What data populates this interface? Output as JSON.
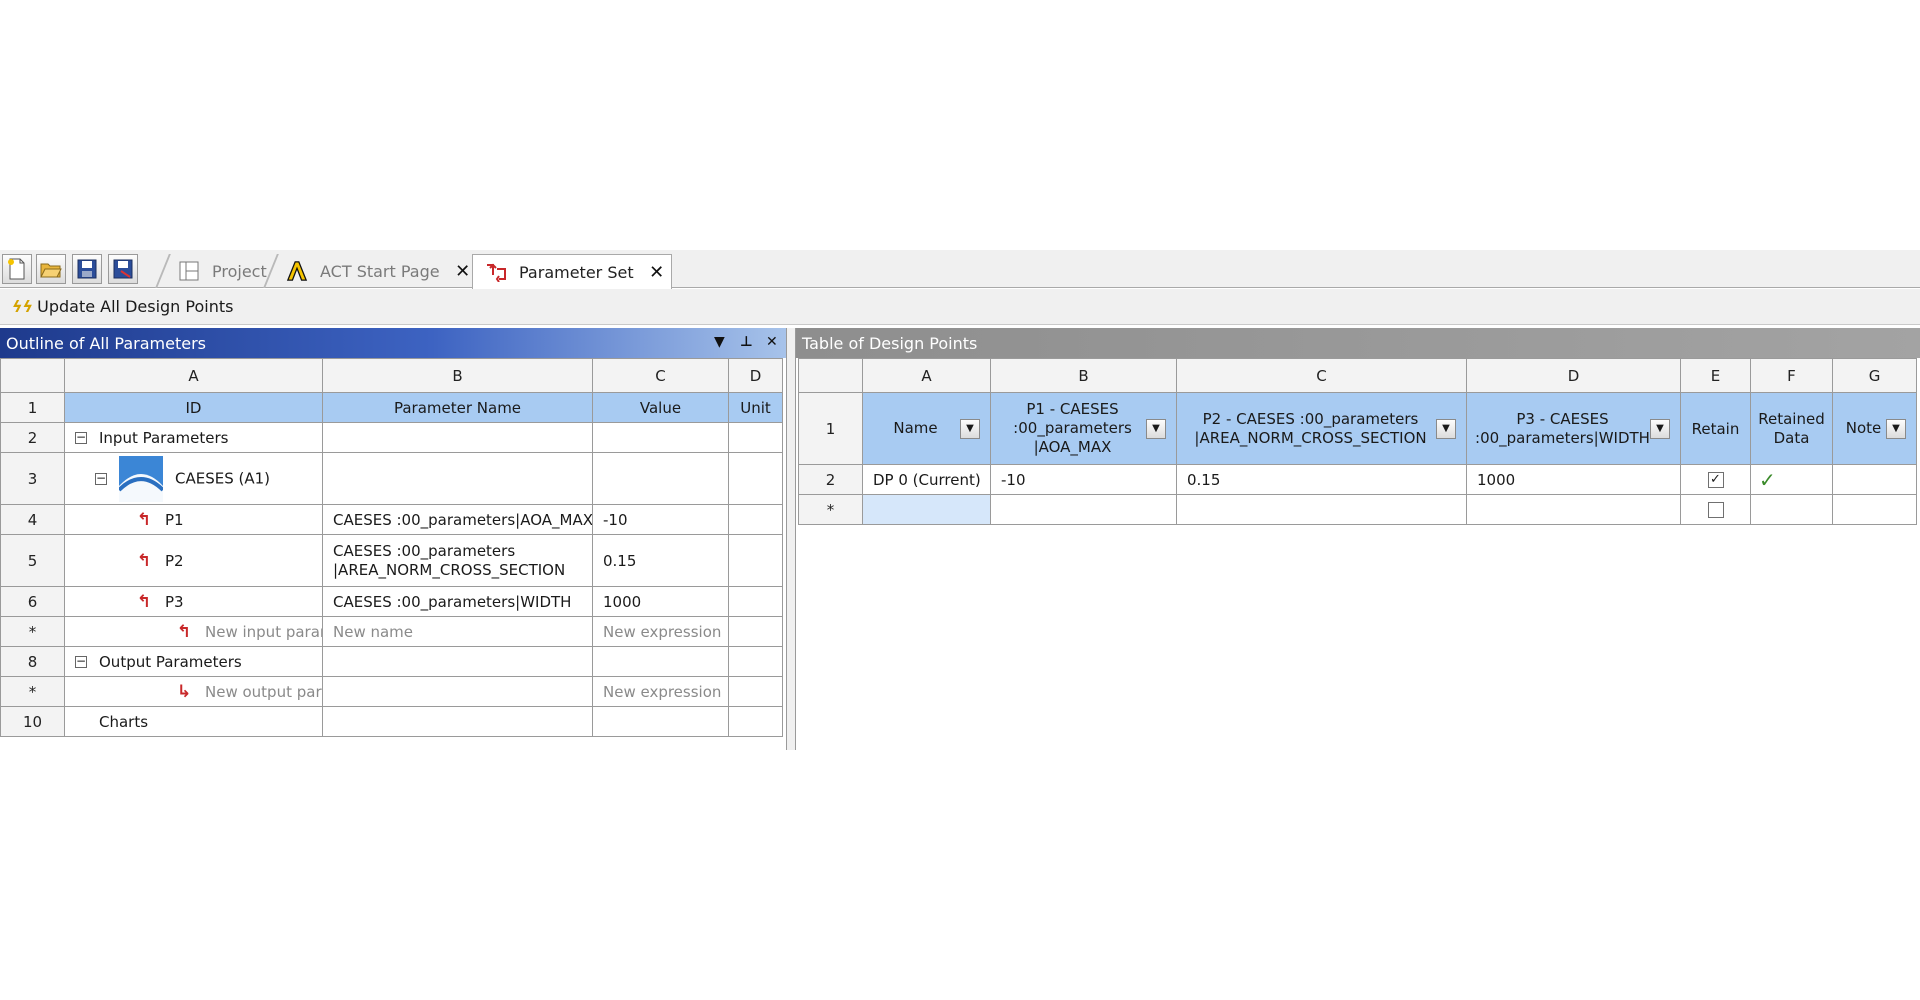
{
  "toolbar": {
    "buttons": [
      "new-file-icon",
      "open-folder-icon",
      "save-icon",
      "save-as-icon"
    ]
  },
  "tabs": [
    {
      "label": "Project",
      "icon": "project-icon",
      "active": false,
      "closable": false
    },
    {
      "label": "ACT Start Page",
      "icon": "ansys-logo-icon",
      "active": false,
      "closable": true
    },
    {
      "label": "Parameter Set",
      "icon": "parameter-set-icon",
      "active": true,
      "closable": true
    }
  ],
  "actions": {
    "update_all": "Update All Design Points"
  },
  "outline": {
    "title": "Outline of All Parameters",
    "columns": [
      "A",
      "B",
      "C",
      "D"
    ],
    "headers": [
      "ID",
      "Parameter Name",
      "Value",
      "Unit"
    ],
    "rows": [
      {
        "num": "2",
        "id": "Input Parameters",
        "name": "",
        "value": "",
        "unit": ""
      },
      {
        "num": "3",
        "id": "CAESES (A1)",
        "name": "",
        "value": "",
        "unit": ""
      },
      {
        "num": "4",
        "id": "P1",
        "name": "CAESES :00_parameters|AOA_MAX",
        "value": "-10",
        "unit": ""
      },
      {
        "num": "5",
        "id": "P2",
        "name_line1": "CAESES :00_parameters",
        "name_line2": "|AREA_NORM_CROSS_SECTION",
        "value": "0.15",
        "unit": ""
      },
      {
        "num": "6",
        "id": "P3",
        "name": "CAESES :00_parameters|WIDTH",
        "value": "1000",
        "unit": ""
      },
      {
        "num": "*",
        "id": "New input parameter",
        "name": "New name",
        "value": "New expression",
        "unit": ""
      },
      {
        "num": "8",
        "id": "Output Parameters",
        "name": "",
        "value": "",
        "unit": ""
      },
      {
        "num": "*",
        "id": "New output parameter",
        "name": "",
        "value": "New expression",
        "unit": ""
      },
      {
        "num": "10",
        "id": "Charts",
        "name": "",
        "value": "",
        "unit": ""
      }
    ]
  },
  "design_points": {
    "title": "Table of Design Points",
    "columns": [
      "A",
      "B",
      "C",
      "D",
      "E",
      "F",
      "G"
    ],
    "headers": {
      "name": "Name",
      "p1_l1": "P1 - CAESES",
      "p1_l2": ":00_parameters",
      "p1_l3": "|AOA_MAX",
      "p2_l1": "P2 - CAESES :00_parameters",
      "p2_l2": "|AREA_NORM_CROSS_SECTION",
      "p3_l1": "P3 - CAESES",
      "p3_l2": ":00_parameters|WIDTH",
      "retain": "Retain",
      "retained_l1": "Retained",
      "retained_l2": "Data",
      "note": "Note"
    },
    "rows": [
      {
        "num": "2",
        "name": "DP 0 (Current)",
        "p1": "-10",
        "p2": "0.15",
        "p3": "1000",
        "retain": true,
        "retained_data": true,
        "note": ""
      },
      {
        "num": "*",
        "name": "",
        "p1": "",
        "p2": "",
        "p3": "",
        "retain": false,
        "retained_data": false,
        "note": ""
      }
    ],
    "header_row_num": "1"
  }
}
